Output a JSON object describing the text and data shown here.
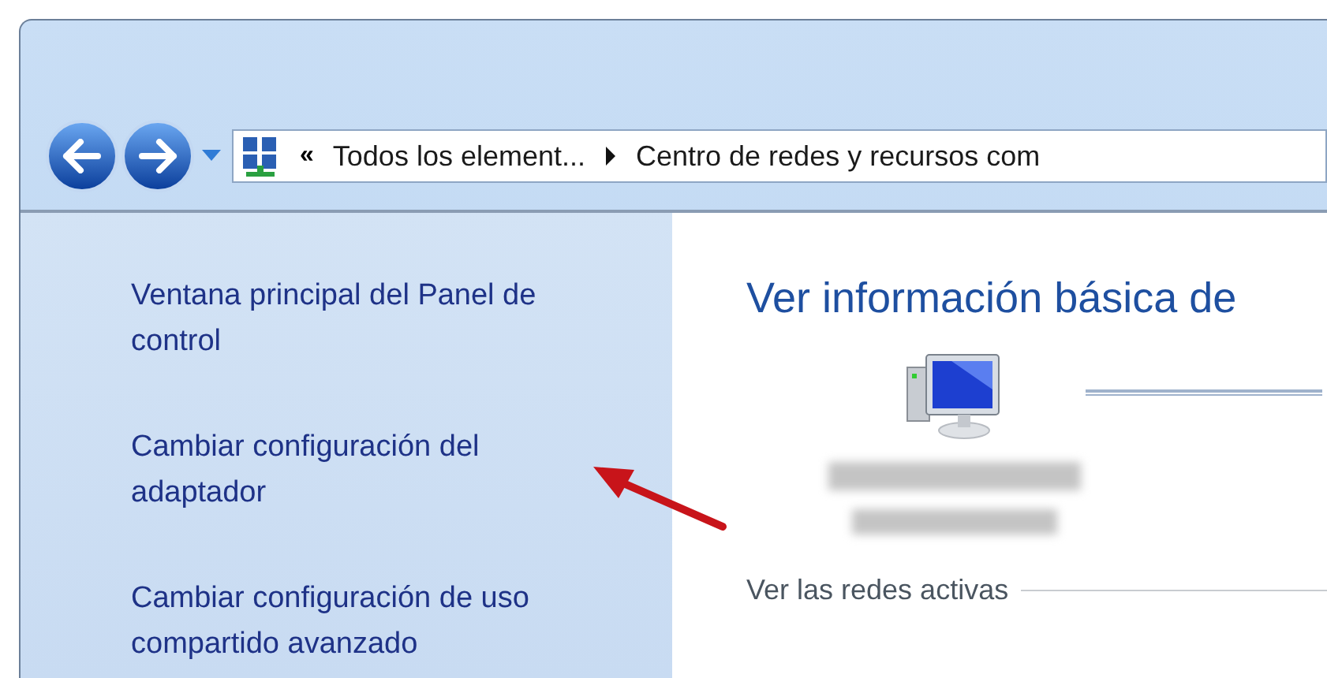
{
  "navigation": {
    "breadcrumb_separator": "«",
    "breadcrumbs": [
      "Todos los element...",
      "Centro de redes y recursos com"
    ]
  },
  "sidebar": {
    "links": [
      "Ventana principal del Panel de control",
      "Cambiar configuración del adaptador",
      "Cambiar configuración de uso compartido avanzado"
    ]
  },
  "content": {
    "heading": "Ver información básica de",
    "section_label": "Ver las redes activas"
  }
}
